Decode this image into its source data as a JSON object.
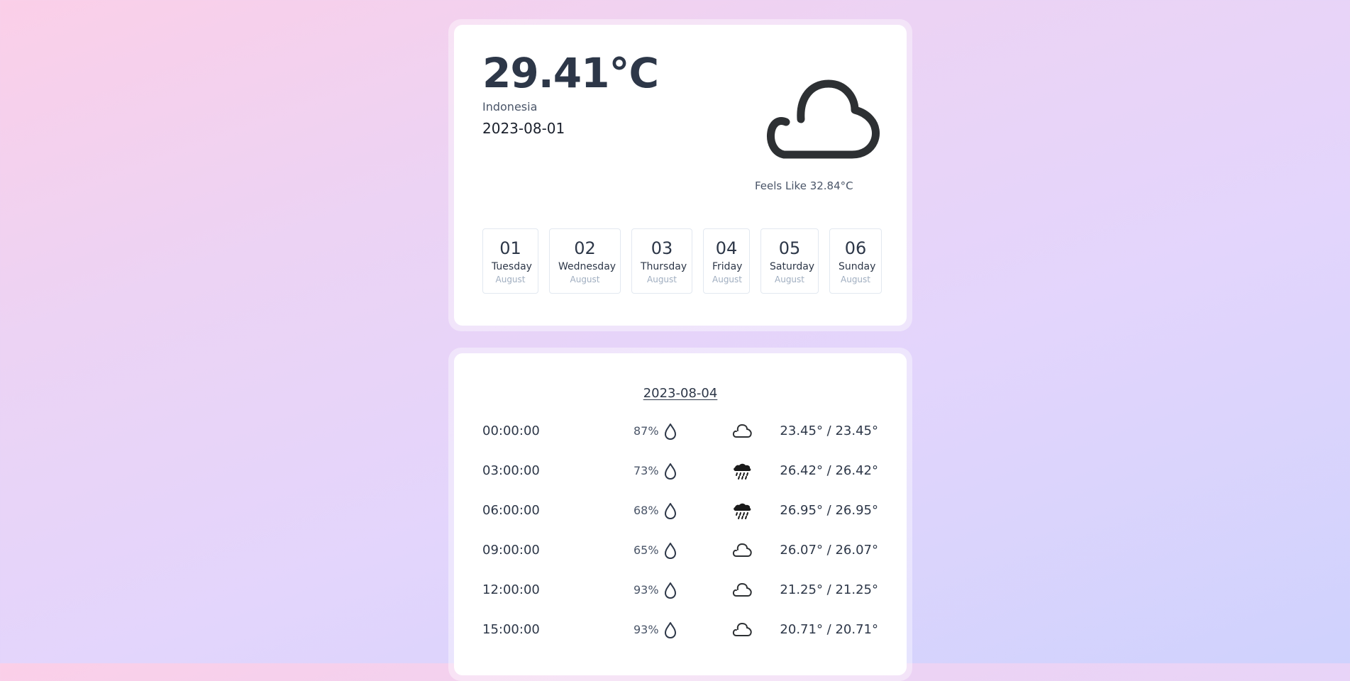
{
  "current": {
    "temperature": "29.41°C",
    "location": "Indonesia",
    "date": "2023-08-01",
    "feels_like": "Feels Like 32.84°C",
    "icon": "cloud-icon"
  },
  "days": [
    {
      "num": "01",
      "name": "Tuesday",
      "month": "August"
    },
    {
      "num": "02",
      "name": "Wednesday",
      "month": "August"
    },
    {
      "num": "03",
      "name": "Thursday",
      "month": "August"
    },
    {
      "num": "04",
      "name": "Friday",
      "month": "August"
    },
    {
      "num": "05",
      "name": "Saturday",
      "month": "August"
    },
    {
      "num": "06",
      "name": "Sunday",
      "month": "August"
    }
  ],
  "hourly": {
    "date": "2023-08-04",
    "rows": [
      {
        "time": "00:00:00",
        "humidity": "87%",
        "icon": "cloud-icon",
        "range": "23.45° / 23.45°"
      },
      {
        "time": "03:00:00",
        "humidity": "73%",
        "icon": "rain-icon",
        "range": "26.42° / 26.42°"
      },
      {
        "time": "06:00:00",
        "humidity": "68%",
        "icon": "rain-icon",
        "range": "26.95° / 26.95°"
      },
      {
        "time": "09:00:00",
        "humidity": "65%",
        "icon": "cloud-icon",
        "range": "26.07° / 26.07°"
      },
      {
        "time": "12:00:00",
        "humidity": "93%",
        "icon": "cloud-icon",
        "range": "21.25° / 21.25°"
      },
      {
        "time": "15:00:00",
        "humidity": "93%",
        "icon": "cloud-icon",
        "range": "20.71° / 20.71°"
      }
    ]
  }
}
